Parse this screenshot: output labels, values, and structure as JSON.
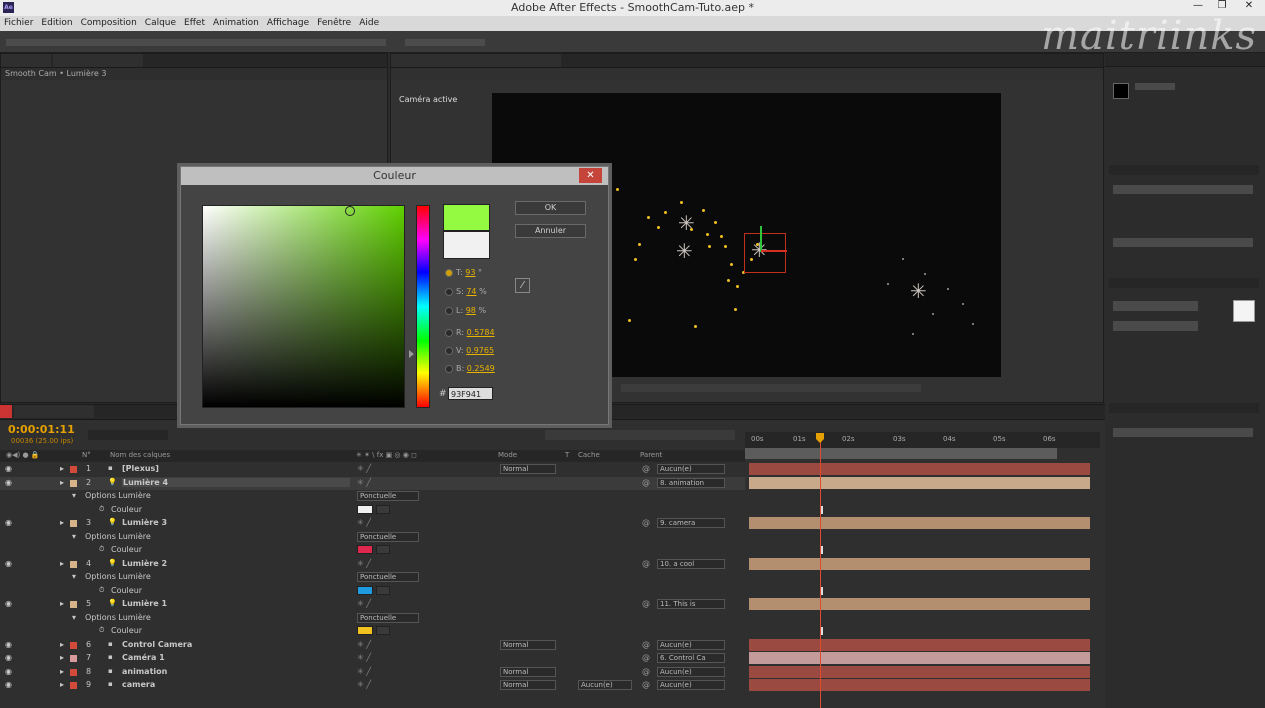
{
  "window": {
    "title": "Adobe After Effects - SmoothCam-Tuto.aep *",
    "app_icon": "Ae"
  },
  "watermark": "maitriinks",
  "menu": [
    "Fichier",
    "Edition",
    "Composition",
    "Calque",
    "Effet",
    "Animation",
    "Affichage",
    "Fenêtre",
    "Aide"
  ],
  "project_panel": {
    "breadcrumb": "Smooth Cam • Lumière 3"
  },
  "comp_panel": {
    "view_label": "Caméra active"
  },
  "color_dialog": {
    "title": "Couleur",
    "ok_label": "OK",
    "cancel_label": "Annuler",
    "new_color": "#93F941",
    "old_color": "#F1F1F1",
    "fields": [
      {
        "letter": "T",
        "value": "93",
        "unit": "°"
      },
      {
        "letter": "S",
        "value": "74",
        "unit": "%"
      },
      {
        "letter": "L",
        "value": "98",
        "unit": "%"
      },
      {
        "letter": "R",
        "value": "0.5784",
        "unit": ""
      },
      {
        "letter": "V",
        "value": "0.9765",
        "unit": ""
      },
      {
        "letter": "B",
        "value": "0.2549",
        "unit": ""
      }
    ],
    "hex": "93F941"
  },
  "timeline": {
    "timecode": "0:00:01:11",
    "fps_info": "00036 (25.00 ips)",
    "columns": {
      "num": "N°",
      "name": "Nom des calques",
      "mode": "Mode",
      "t": "T",
      "cache": "Cache",
      "parent": "Parent"
    },
    "ruler": [
      "00s",
      "01s",
      "02s",
      "03s",
      "04s",
      "05s",
      "06s"
    ],
    "rows": [
      {
        "kind": "layer",
        "num": "1",
        "name": "[Plexus]",
        "label": "#d24b3a",
        "mode": "Normal",
        "parent": "Aucun(e)",
        "bar": "#9a4a40"
      },
      {
        "kind": "layer",
        "num": "2",
        "name": "Lumière 4",
        "label": "#d8b48a",
        "parent": "8. animation",
        "bar": "#c8a98a",
        "selected": true
      },
      {
        "kind": "option",
        "name": "Options Lumière",
        "value": "Ponctuelle"
      },
      {
        "kind": "prop",
        "name": "Couleur",
        "swatch": "#f1f1f1"
      },
      {
        "kind": "layer",
        "num": "3",
        "name": "Lumière 3",
        "label": "#d8b48a",
        "parent": "9. camera",
        "bar": "#b38f70"
      },
      {
        "kind": "option",
        "name": "Options Lumière",
        "value": "Ponctuelle"
      },
      {
        "kind": "prop",
        "name": "Couleur",
        "swatch": "#e0284f"
      },
      {
        "kind": "layer",
        "num": "4",
        "name": "Lumière 2",
        "label": "#d8b48a",
        "parent": "10. a cool",
        "bar": "#b38f70"
      },
      {
        "kind": "option",
        "name": "Options Lumière",
        "value": "Ponctuelle"
      },
      {
        "kind": "prop",
        "name": "Couleur",
        "swatch": "#1e9be0"
      },
      {
        "kind": "layer",
        "num": "5",
        "name": "Lumière 1",
        "label": "#d8b48a",
        "parent": "11. This is",
        "bar": "#b38f70"
      },
      {
        "kind": "option",
        "name": "Options Lumière",
        "value": "Ponctuelle"
      },
      {
        "kind": "prop",
        "name": "Couleur",
        "swatch": "#f2c21e"
      },
      {
        "kind": "layer",
        "num": "6",
        "name": "Control Camera",
        "label": "#d24b3a",
        "mode": "Normal",
        "parent": "Aucun(e)",
        "bar": "#9a4a40"
      },
      {
        "kind": "layer",
        "num": "7",
        "name": "Caméra 1",
        "label": "#d89a9a",
        "parent": "6. Control Ca",
        "bar": "#c49b9b"
      },
      {
        "kind": "layer",
        "num": "8",
        "name": "animation",
        "label": "#d24b3a",
        "mode": "Normal",
        "parent": "Aucun(e)",
        "bar": "#9a4a40"
      },
      {
        "kind": "layer",
        "num": "9",
        "name": "camera",
        "label": "#d24b3a",
        "mode": "Normal",
        "cache": "Aucun(e)",
        "parent": "Aucun(e)",
        "bar": "#9a4a40"
      }
    ]
  }
}
